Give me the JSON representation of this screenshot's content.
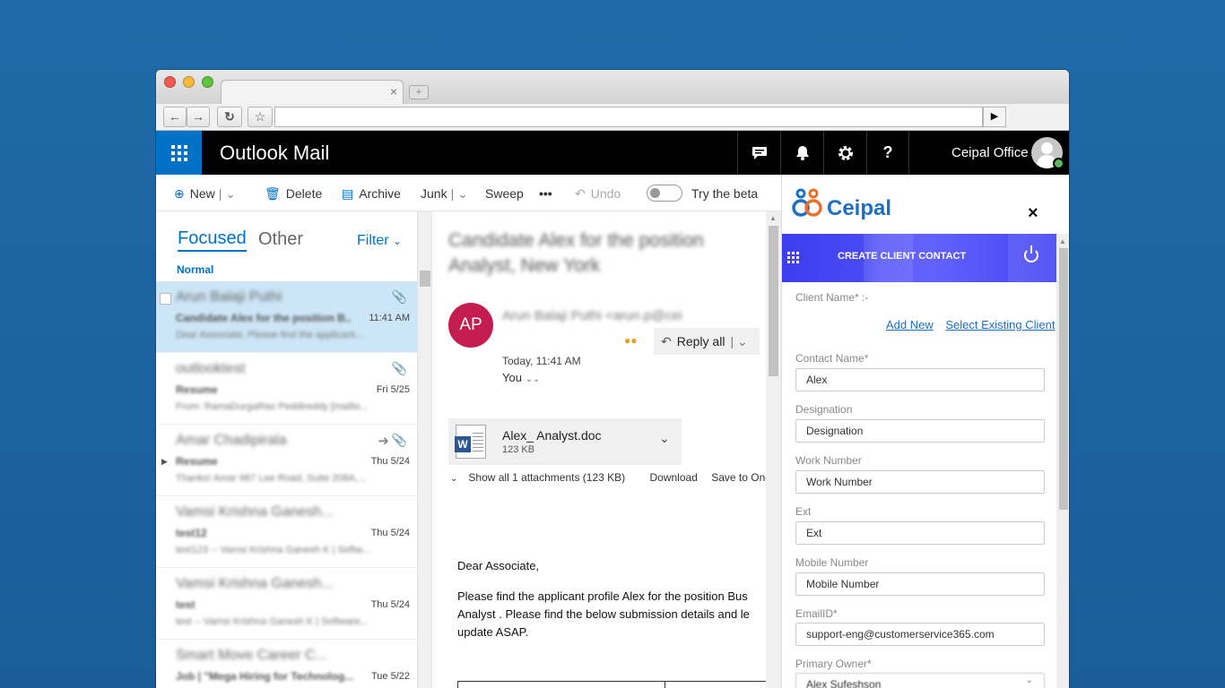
{
  "browser": {
    "tab_close": "×",
    "new_tab": "+"
  },
  "app": {
    "title": "Outlook Mail",
    "user_name": "Ceipal Office"
  },
  "header_icons": [
    "chat-icon",
    "bell-icon",
    "gear-icon",
    "help-icon"
  ],
  "header_help": "?",
  "commands": {
    "new": "New",
    "delete": "Delete",
    "archive": "Archive",
    "junk": "Junk",
    "sweep": "Sweep",
    "more": "•••",
    "undo": "Undo",
    "beta": "Try the beta"
  },
  "list": {
    "focused": "Focused",
    "other": "Other",
    "filter": "Filter",
    "group": "Normal",
    "messages": [
      {
        "sender": "Arun Balaji Puthi",
        "subject": "Candidate Alex for the position B..",
        "preview": "Dear Associate, Please find the applicant...",
        "date": "11:41 AM"
      },
      {
        "sender": "outlooktest",
        "subject": "Resume",
        "preview": "From: RamaDurgaRao Peddireddy [mailto...",
        "date": "Fri 5/25"
      },
      {
        "sender": "Amar Chadipirala",
        "subject": "Resume",
        "preview": "Thanks! Amar 987 Lee Road, Suite 208A,...",
        "date": "Thu 5/24"
      },
      {
        "sender": "Vamsi Krishna Ganesh...",
        "subject": "test12",
        "preview": "test123 -- Vamsi Krishna Ganesh K | Softw...",
        "date": "Thu 5/24"
      },
      {
        "sender": "Vamsi Krishna Ganesh...",
        "subject": "test",
        "preview": "test -- Vamsi Krishna Ganesh K | Software...",
        "date": "Thu 5/24"
      },
      {
        "sender": "Smart Move Career C...",
        "subject": "Job | \"Mega Hiring for Technolog...",
        "preview": "",
        "date": "Tue 5/22"
      }
    ]
  },
  "reading": {
    "subject": "Candidate Alex for the position Analyst, New York",
    "avatar_initials": "AP",
    "from": "Arun Balaji Puthi <arun.p@cei",
    "reply_all": "Reply all",
    "date": "Today, 11:41 AM",
    "to": "You",
    "attachment_name": "Alex_ Analyst.doc",
    "attachment_size": "123 KB",
    "show_all": "Show all 1 attachments (123 KB)",
    "download": "Download",
    "save": "Save to One",
    "greeting": "Dear Associate,",
    "body_line1": "Please find the applicant profile Alex for the position Bus",
    "body_line2": "Analyst . Please find the below submission details and le",
    "body_line3": "update ASAP."
  },
  "ceipal": {
    "logo": "Ceipal",
    "close": "×",
    "bar_title": "CREATE CLIENT CONTACT",
    "client_name_label": "Client Name* :-",
    "add_new": "Add New",
    "select_existing": "Select Existing Client",
    "fields": [
      {
        "label": "Contact Name*",
        "value": "Alex"
      },
      {
        "label": "Designation",
        "value": "Designation"
      },
      {
        "label": "Work Number",
        "value": "Work Number"
      },
      {
        "label": "Ext",
        "value": "Ext"
      },
      {
        "label": "Mobile Number",
        "value": "Mobile Number"
      },
      {
        "label": "EmailID*",
        "value": "support-eng@customerservice365.com"
      },
      {
        "label": "Primary Owner*",
        "value": "Alex Sufeshson"
      }
    ],
    "logo_color": "#e8702a",
    "brand_color": "#1b6fc5"
  }
}
